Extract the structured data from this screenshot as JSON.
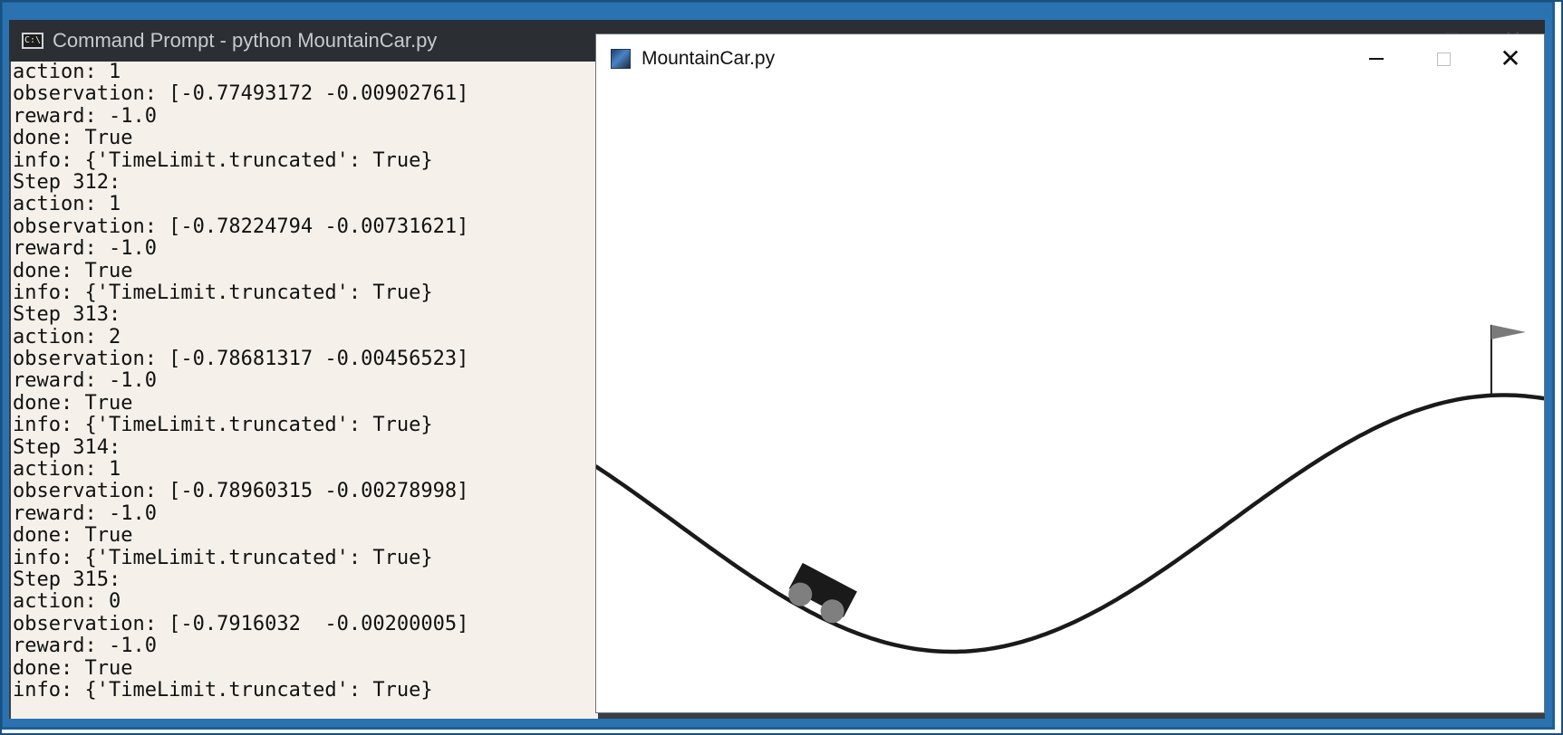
{
  "cmd_window": {
    "title": "Command Prompt - python  MountainCar.py",
    "icon_text": "C:\\",
    "console_lines": [
      "action: 1",
      "observation: [-0.77493172 -0.00902761]",
      "reward: -1.0",
      "done: True",
      "info: {'TimeLimit.truncated': True}",
      "Step 312:",
      "action: 1",
      "observation: [-0.78224794 -0.00731621]",
      "reward: -1.0",
      "done: True",
      "info: {'TimeLimit.truncated': True}",
      "Step 313:",
      "action: 2",
      "observation: [-0.78681317 -0.00456523]",
      "reward: -1.0",
      "done: True",
      "info: {'TimeLimit.truncated': True}",
      "Step 314:",
      "action: 1",
      "observation: [-0.78960315 -0.00278998]",
      "reward: -1.0",
      "done: True",
      "info: {'TimeLimit.truncated': True}",
      "Step 315:",
      "action: 0",
      "observation: [-0.7916032  -0.00200005]",
      "reward: -1.0",
      "done: True",
      "info: {'TimeLimit.truncated': True}"
    ],
    "controls": {
      "minimize": "—",
      "maximize": "□",
      "close": "✕"
    }
  },
  "gym_window": {
    "title": "MountainCar.py",
    "close_glyph": "✕",
    "scene": {
      "car_position": -0.7916032,
      "car_velocity": -0.00200005,
      "position_range": [
        -1.2,
        0.6
      ],
      "goal_position": 0.5,
      "track_color": "#1a1a1a",
      "car_color": "#1a1a1a",
      "wheel_color": "#7f7f7f",
      "flag_color": "#7a7a7a"
    }
  },
  "colors": {
    "desktop": "#2a73b0",
    "console_bg": "#f5f1ea",
    "titlebar_dark": "#2b2f34"
  }
}
